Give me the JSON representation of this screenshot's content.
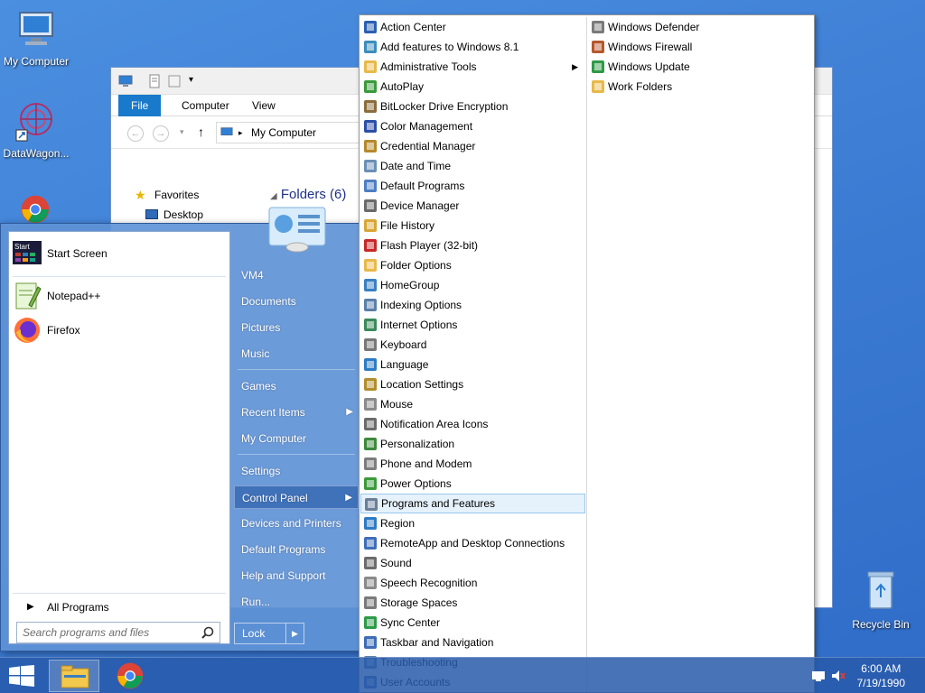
{
  "desktop": {
    "icons": [
      {
        "label": "My Computer",
        "icon": "computer-icon"
      },
      {
        "label": "DataWagon...",
        "icon": "datawagon-icon"
      },
      {
        "label": "Recycle Bin",
        "icon": "recycle-bin-icon"
      }
    ]
  },
  "explorer": {
    "ribbon_tabs": [
      "File",
      "Computer",
      "View"
    ],
    "address": "My Computer",
    "nav": [
      {
        "label": "Favorites"
      },
      {
        "label": "Desktop"
      }
    ],
    "folders_header": "Folders (6)"
  },
  "start_menu": {
    "pinned": [
      {
        "label": "Start Screen",
        "icon": "start-screen-icon"
      },
      {
        "label": "Notepad++",
        "icon": "notepadpp-icon"
      },
      {
        "label": "Firefox",
        "icon": "firefox-icon"
      }
    ],
    "all_programs": "All Programs",
    "search_placeholder": "Search programs and files",
    "right": [
      {
        "label": "VM4"
      },
      {
        "label": "Documents"
      },
      {
        "label": "Pictures"
      },
      {
        "label": "Music"
      },
      {
        "label": "Games"
      },
      {
        "label": "Recent Items"
      },
      {
        "label": "My Computer"
      },
      {
        "label": "Settings"
      },
      {
        "label": "Control Panel"
      },
      {
        "label": "Devices and Printers"
      },
      {
        "label": "Default Programs"
      },
      {
        "label": "Help and Support"
      },
      {
        "label": "Run..."
      }
    ],
    "lock_label": "Lock"
  },
  "control_panel": {
    "col1": [
      {
        "label": "Action Center",
        "icon": "flag-icon",
        "color": "#2a5fb0"
      },
      {
        "label": "Add features to Windows 8.1",
        "icon": "add-features-icon",
        "color": "#3c8dbc"
      },
      {
        "label": "Administrative Tools",
        "icon": "folder-icon",
        "color": "#e8b94a"
      },
      {
        "label": "AutoPlay",
        "icon": "autoplay-icon",
        "color": "#3a9a3a"
      },
      {
        "label": "BitLocker Drive Encryption",
        "icon": "bitlocker-icon",
        "color": "#8a6d3b"
      },
      {
        "label": "Color Management",
        "icon": "color-management-icon",
        "color": "#2b4fa8"
      },
      {
        "label": "Credential Manager",
        "icon": "credential-icon",
        "color": "#b5892c"
      },
      {
        "label": "Date and Time",
        "icon": "clock-icon",
        "color": "#6b8fb5"
      },
      {
        "label": "Default Programs",
        "icon": "default-programs-icon",
        "color": "#4d7ec2"
      },
      {
        "label": "Device Manager",
        "icon": "device-manager-icon",
        "color": "#6a6a6a"
      },
      {
        "label": "File History",
        "icon": "file-history-icon",
        "color": "#d8a637"
      },
      {
        "label": "Flash Player (32-bit)",
        "icon": "flash-icon",
        "color": "#c62828"
      },
      {
        "label": "Folder Options",
        "icon": "folder-icon",
        "color": "#e8b94a"
      },
      {
        "label": "HomeGroup",
        "icon": "homegroup-icon",
        "color": "#3a7fc1"
      },
      {
        "label": "Indexing Options",
        "icon": "indexing-icon",
        "color": "#5a7fa8"
      },
      {
        "label": "Internet Options",
        "icon": "internet-icon",
        "color": "#3a8a5a"
      },
      {
        "label": "Keyboard",
        "icon": "keyboard-icon",
        "color": "#777777"
      },
      {
        "label": "Language",
        "icon": "language-icon",
        "color": "#2d7bc4"
      },
      {
        "label": "Location Settings",
        "icon": "location-icon",
        "color": "#b28d2b"
      },
      {
        "label": "Mouse",
        "icon": "mouse-icon",
        "color": "#8a8a8a"
      },
      {
        "label": "Notification Area Icons",
        "icon": "notification-icon",
        "color": "#6b6b6b"
      },
      {
        "label": "Personalization",
        "icon": "personalization-icon",
        "color": "#3b8a3b"
      },
      {
        "label": "Phone and Modem",
        "icon": "phone-icon",
        "color": "#7d7d7d"
      },
      {
        "label": "Power Options",
        "icon": "power-icon",
        "color": "#3a9a3a"
      },
      {
        "label": "Programs and Features",
        "icon": "programs-features-icon",
        "color": "#6b7f99"
      },
      {
        "label": "Region",
        "icon": "region-icon",
        "color": "#2d7bc4"
      },
      {
        "label": "RemoteApp and Desktop Connections",
        "icon": "remoteapp-icon",
        "color": "#3e6fb8"
      },
      {
        "label": "Sound",
        "icon": "sound-icon",
        "color": "#6b6b6b"
      },
      {
        "label": "Speech Recognition",
        "icon": "speech-icon",
        "color": "#8a8a8a"
      },
      {
        "label": "Storage Spaces",
        "icon": "storage-icon",
        "color": "#7a7a7a"
      },
      {
        "label": "Sync Center",
        "icon": "sync-icon",
        "color": "#2e9a47"
      },
      {
        "label": "Taskbar and Navigation",
        "icon": "taskbar-icon",
        "color": "#3d6db5"
      },
      {
        "label": "Troubleshooting",
        "icon": "troubleshooting-icon",
        "color": "#5a7fa8"
      },
      {
        "label": "User Accounts",
        "icon": "user-accounts-icon",
        "color": "#4a70b0"
      }
    ],
    "col2": [
      {
        "label": "Windows Defender",
        "icon": "defender-icon",
        "color": "#7a7a7a"
      },
      {
        "label": "Windows Firewall",
        "icon": "firewall-icon",
        "color": "#b5572c"
      },
      {
        "label": "Windows Update",
        "icon": "windows-update-icon",
        "color": "#2e9a47"
      },
      {
        "label": "Work Folders",
        "icon": "work-folders-icon",
        "color": "#e8b94a"
      }
    ],
    "highlighted": "Programs and Features"
  },
  "taskbar": {
    "time": "6:00 AM",
    "date": "7/19/1990"
  }
}
